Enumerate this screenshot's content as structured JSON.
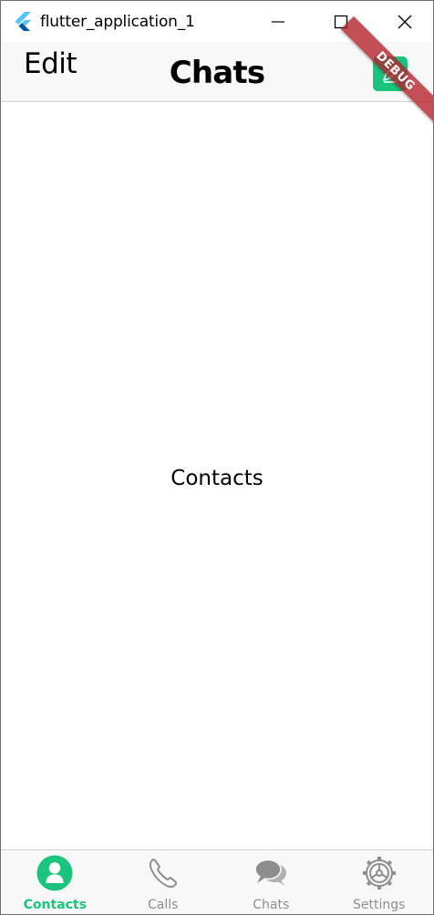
{
  "window": {
    "title": "flutter_application_1"
  },
  "appbar": {
    "edit_label": "Edit",
    "title": "Chats"
  },
  "debug_banner": {
    "label": "DEBUG"
  },
  "content": {
    "label": "Contacts"
  },
  "bottom_nav": {
    "items": [
      {
        "label": "Contacts",
        "icon": "person-icon",
        "active": true
      },
      {
        "label": "Calls",
        "icon": "phone-icon",
        "active": false
      },
      {
        "label": "Chats",
        "icon": "chat-bubbles-icon",
        "active": false
      },
      {
        "label": "Settings",
        "icon": "gear-icon",
        "active": false
      }
    ]
  },
  "colors": {
    "accent": "#1bc47d",
    "inactive": "#8e8e8e",
    "bar_background": "#f8f8f8",
    "debug_banner": "#b41e28"
  }
}
